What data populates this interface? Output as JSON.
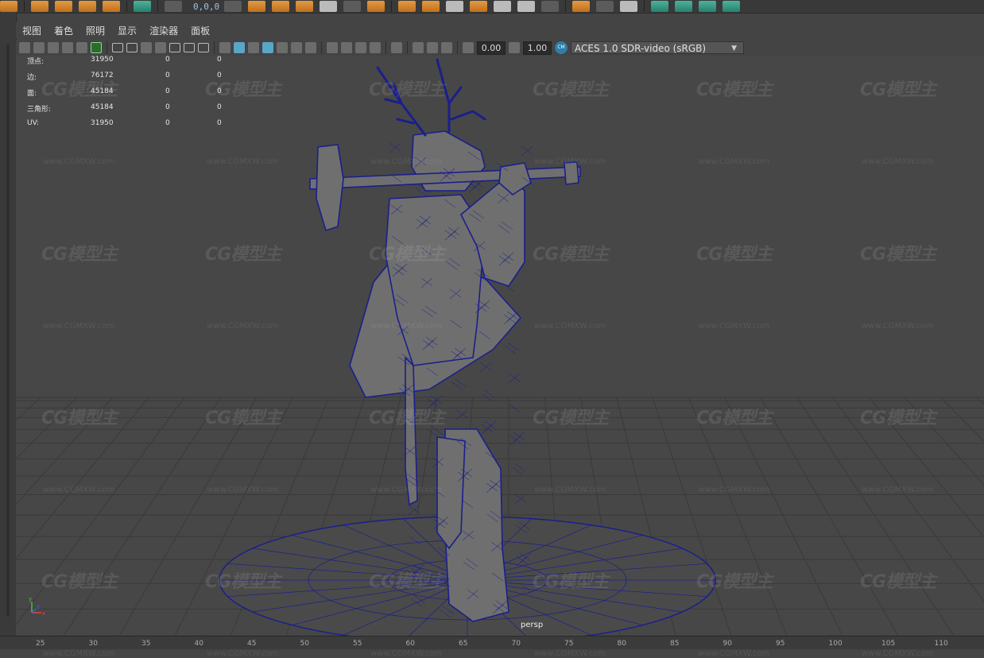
{
  "shelf": {
    "coord_readout": "0,0,0"
  },
  "menu": [
    "视图",
    "着色",
    "照明",
    "显示",
    "渲染器",
    "面板"
  ],
  "toolbar": {
    "gamma_value": "0.00",
    "exposure_value": "1.00",
    "color_space": "ACES 1.0 SDR-video (sRGB)"
  },
  "hud": {
    "rows": [
      {
        "label": "顶点:",
        "v1": "31950",
        "v2": "0",
        "v3": "0"
      },
      {
        "label": "边:",
        "v1": "76172",
        "v2": "0",
        "v3": "0"
      },
      {
        "label": "面:",
        "v1": "45184",
        "v2": "0",
        "v3": "0"
      },
      {
        "label": "三角形:",
        "v1": "45184",
        "v2": "0",
        "v3": "0"
      },
      {
        "label": "UV:",
        "v1": "31950",
        "v2": "0",
        "v3": "0"
      }
    ]
  },
  "viewport": {
    "camera_label": "persp",
    "wireframe_color": "#1a1f8c",
    "watermark_text": "CG模型主",
    "watermark_url": "www.CGMXW.com"
  },
  "timeline": {
    "ticks": [
      "25",
      "30",
      "35",
      "40",
      "45",
      "50",
      "55",
      "60",
      "65",
      "70",
      "75",
      "80",
      "85",
      "90",
      "95",
      "100",
      "105",
      "110"
    ]
  },
  "colors": {
    "viewport_bg": "#474747",
    "accent_orange": "#e39a43",
    "wire_blue": "#1a1f8c",
    "active_blue": "#5aa6c8"
  }
}
